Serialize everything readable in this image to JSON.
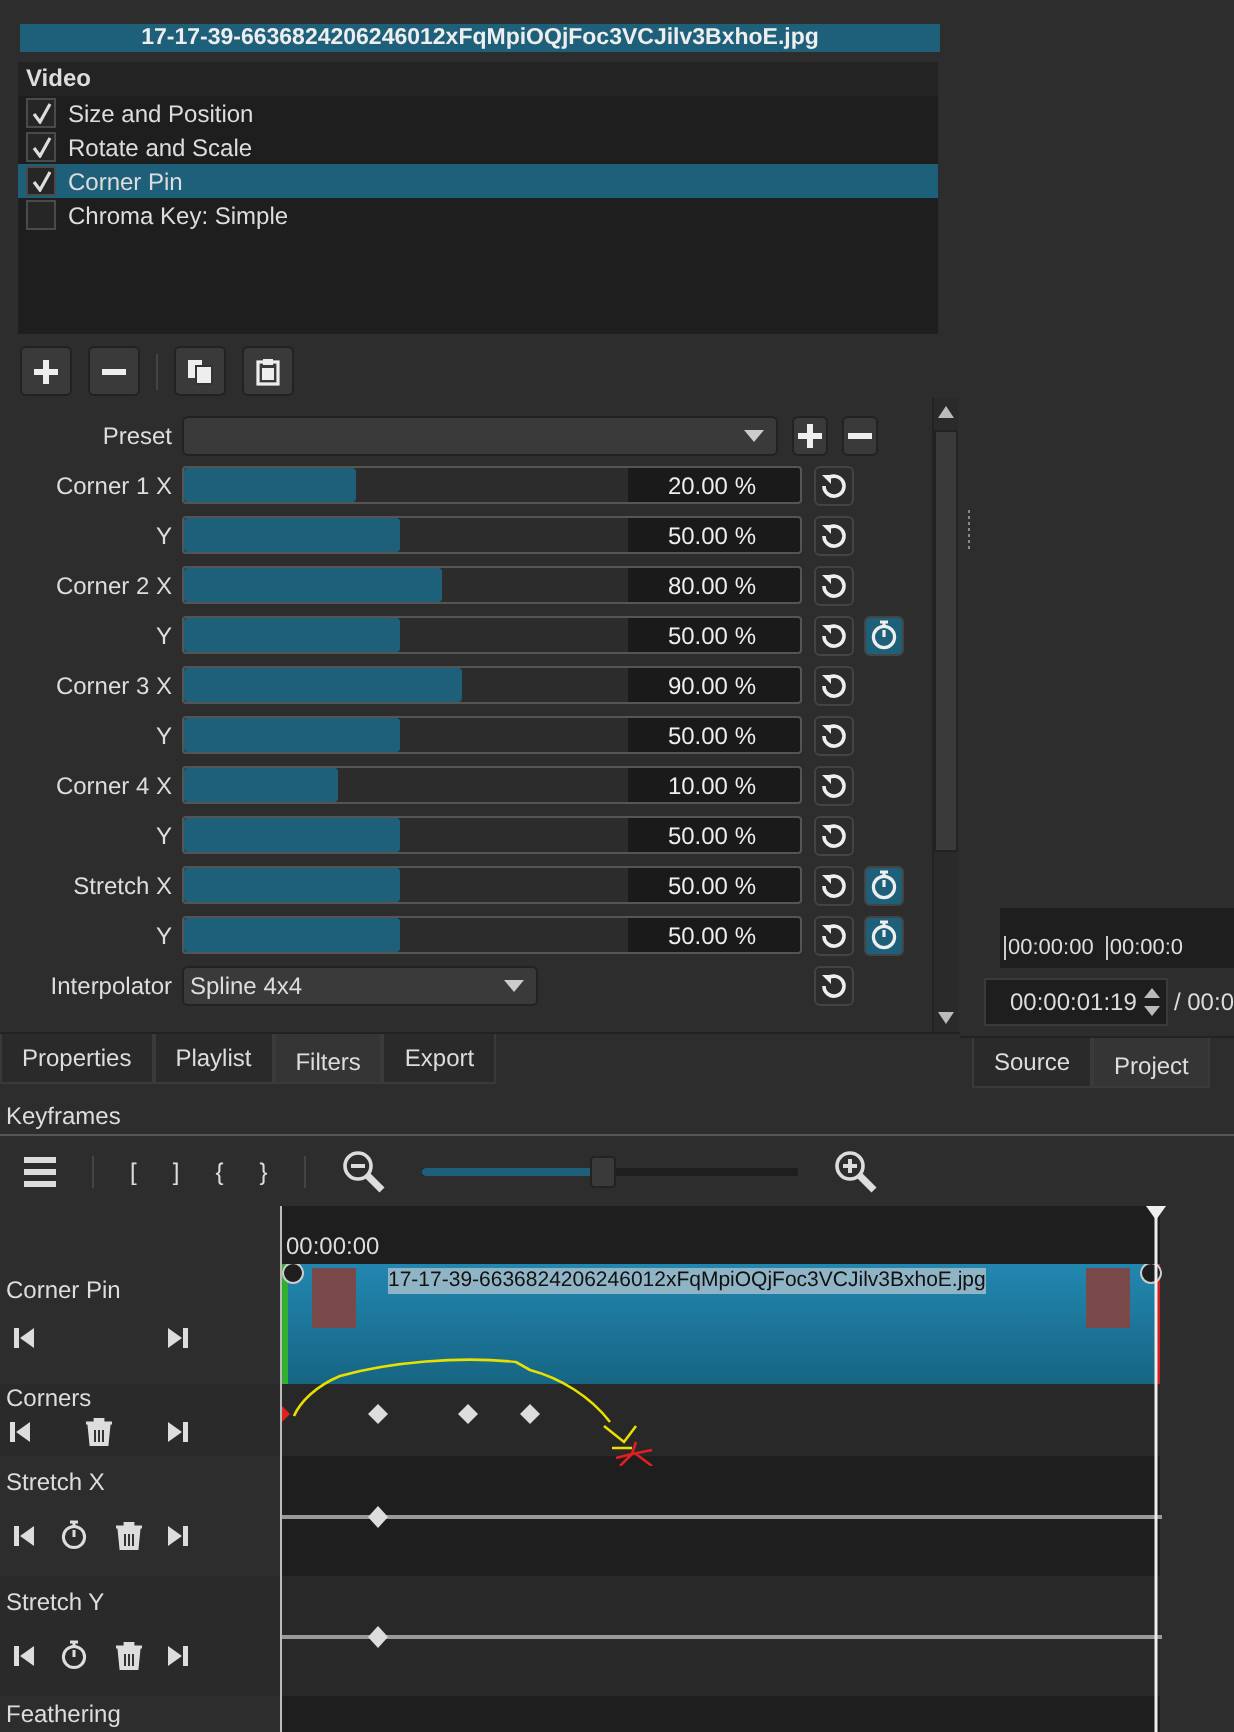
{
  "filter_panel": {
    "title": "17-17-39-6636824206246012xFqMpiOQjFoc3VCJilv3BxhoE.jpg",
    "list_header": "Video",
    "items": [
      {
        "label": "Size and Position",
        "checked": true,
        "selected": false
      },
      {
        "label": "Rotate and Scale",
        "checked": true,
        "selected": false
      },
      {
        "label": "Corner Pin",
        "checked": true,
        "selected": true
      },
      {
        "label": "Chroma Key: Simple",
        "checked": false,
        "selected": false
      }
    ]
  },
  "parameters": {
    "preset_label": "Preset",
    "rows": [
      {
        "kind": "slider",
        "label": "Corner 1 X",
        "level": 0.28,
        "reading": "20.00 %",
        "keyframe_button": false
      },
      {
        "kind": "slider",
        "label": "Y",
        "level": 0.35,
        "reading": "50.00 %",
        "keyframe_button": false
      },
      {
        "kind": "slider",
        "label": "Corner 2 X",
        "level": 0.42,
        "reading": "80.00 %",
        "keyframe_button": false
      },
      {
        "kind": "slider",
        "label": "Y",
        "level": 0.35,
        "reading": "50.00 %",
        "keyframe_button": true
      },
      {
        "kind": "slider",
        "label": "Corner 3 X",
        "level": 0.45,
        "reading": "90.00 %",
        "keyframe_button": false
      },
      {
        "kind": "slider",
        "label": "Y",
        "level": 0.35,
        "reading": "50.00 %",
        "keyframe_button": false
      },
      {
        "kind": "slider",
        "label": "Corner 4 X",
        "level": 0.25,
        "reading": "10.00 %",
        "keyframe_button": false
      },
      {
        "kind": "slider",
        "label": "Y",
        "level": 0.35,
        "reading": "50.00 %",
        "keyframe_button": false
      },
      {
        "kind": "slider",
        "label": "Stretch X",
        "level": 0.35,
        "reading": "50.00 %",
        "keyframe_button": true
      },
      {
        "kind": "slider",
        "label": "Y",
        "level": 0.35,
        "reading": "50.00 %",
        "keyframe_button": true
      },
      {
        "kind": "dropdown",
        "label": "Interpolator",
        "value": "Spline 4x4"
      }
    ]
  },
  "tabs": [
    {
      "label": "Properties",
      "selected": false
    },
    {
      "label": "Playlist",
      "selected": false
    },
    {
      "label": "Filters",
      "selected": true
    },
    {
      "label": "Export",
      "selected": false
    }
  ],
  "player": {
    "ruler_ticks": [
      "00:00:00",
      "00:00:0"
    ],
    "timecode": "00:00:01:19",
    "duration": "/ 00:0"
  },
  "right_tabs": [
    {
      "label": "Source",
      "selected": false
    },
    {
      "label": "Project",
      "selected": true
    }
  ],
  "keyframes": {
    "title": "Keyframes",
    "toolbar_keys": [
      "[",
      "]",
      "{",
      "}"
    ],
    "zoom": {
      "level": 0.48
    },
    "ruler_time": "00:00:00",
    "tracks": [
      {
        "kind": "clip",
        "name": "Corner Pin",
        "clip_title": "17-17-39-6636824206246012xFqMpiOQjFoc3VCJilv3BxhoE.jpg"
      },
      {
        "kind": "corners",
        "name": "Corners"
      },
      {
        "kind": "curve",
        "name": "Stretch X"
      },
      {
        "kind": "curve",
        "name": "Stretch Y"
      },
      {
        "kind": "cut",
        "name": "Feathering"
      }
    ]
  }
}
